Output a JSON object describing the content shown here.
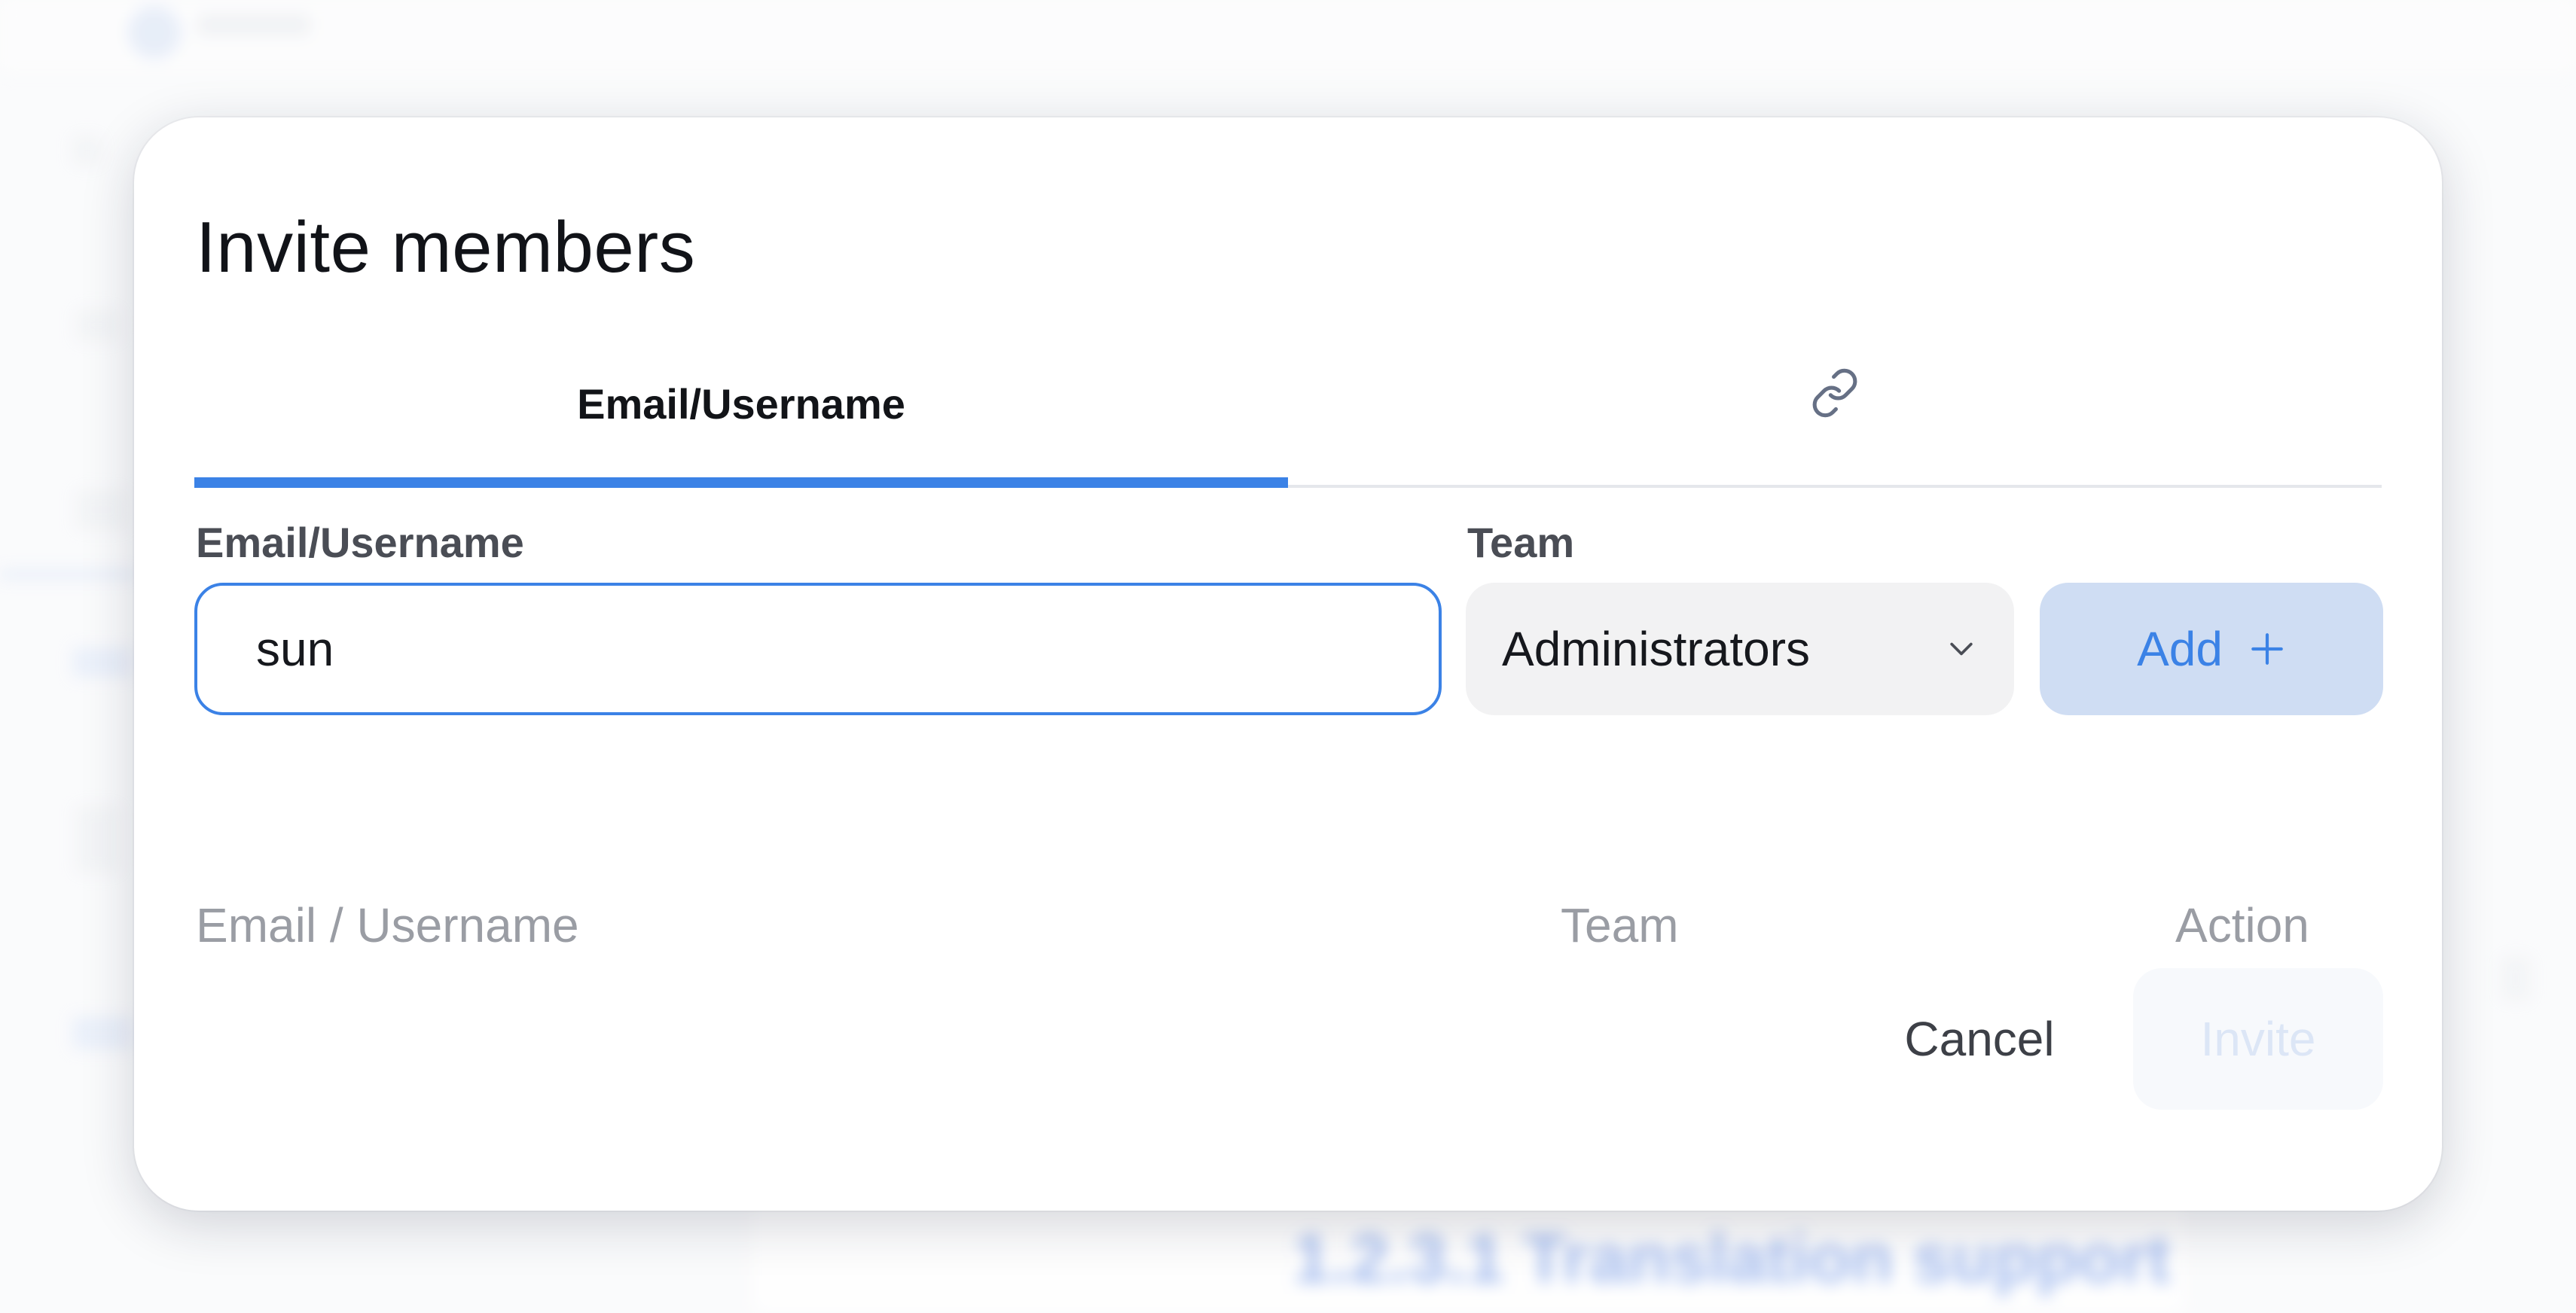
{
  "dialog": {
    "title": "Invite members",
    "tabs": [
      {
        "label": "Email/Username",
        "active": true
      },
      {
        "icon": "link-icon",
        "active": false
      }
    ],
    "form": {
      "email_label": "Email/Username",
      "email_value": "sun",
      "team_label": "Team",
      "team_selected": "Administrators",
      "add_label": "Add"
    },
    "table": {
      "columns": [
        "Email / Username",
        "Team",
        "Action"
      ]
    },
    "footer": {
      "cancel_label": "Cancel",
      "invite_label": "Invite"
    }
  },
  "background": {
    "heading": "1.2.3.1 Translation support"
  },
  "colors": {
    "accent": "#3b82e6",
    "add_button_bg": "#cfddf3",
    "select_bg": "#f2f2f3",
    "muted_text": "#9a9da4",
    "disabled_invite_text": "#dce6f6"
  }
}
